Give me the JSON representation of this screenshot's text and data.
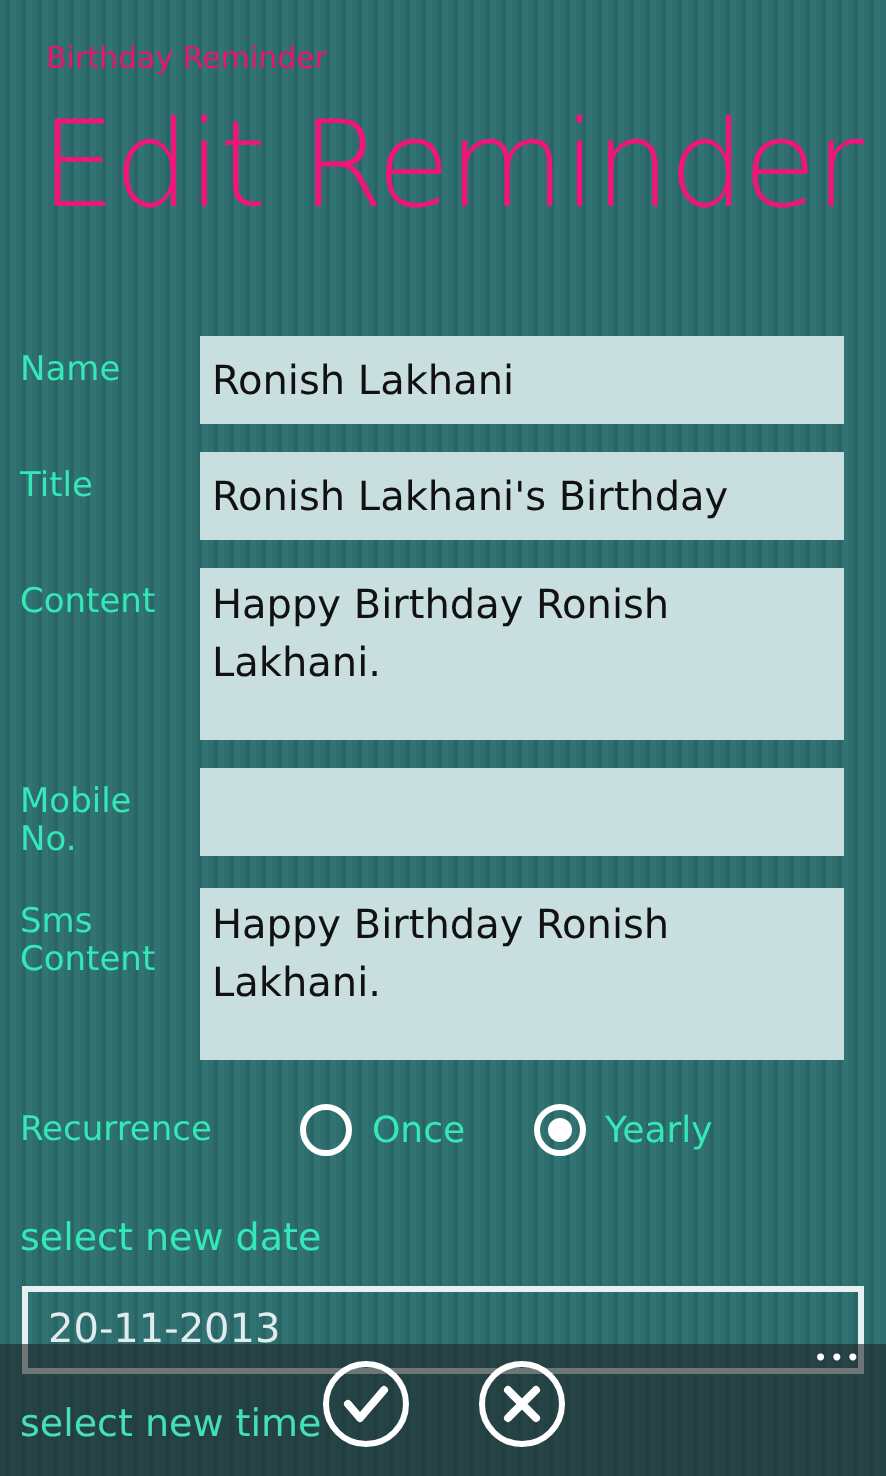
{
  "app_name": "Birthday Reminder",
  "page_title": "Edit Reminder",
  "fields": [
    {
      "label": "Name",
      "value": "Ronish Lakhani",
      "kind": "single"
    },
    {
      "label": "Title",
      "value": "Ronish Lakhani's Birthday",
      "kind": "single"
    },
    {
      "label": "Content",
      "value": "Happy Birthday Ronish Lakhani.",
      "kind": "multi"
    },
    {
      "label": "Mobile No.",
      "kind": "single"
    },
    {
      "label": "Sms Content",
      "value": "Happy Birthday Ronish Lakhani.",
      "kind": "multi"
    }
  ],
  "recurrence": {
    "label": "Recurrence",
    "options": [
      {
        "label": "Once",
        "selected": false
      },
      {
        "label": "Yearly",
        "selected": true
      }
    ]
  },
  "date": {
    "label": "select new date",
    "value": "20-11-2013",
    "more": "•••"
  },
  "time": {
    "label": "select new time"
  }
}
